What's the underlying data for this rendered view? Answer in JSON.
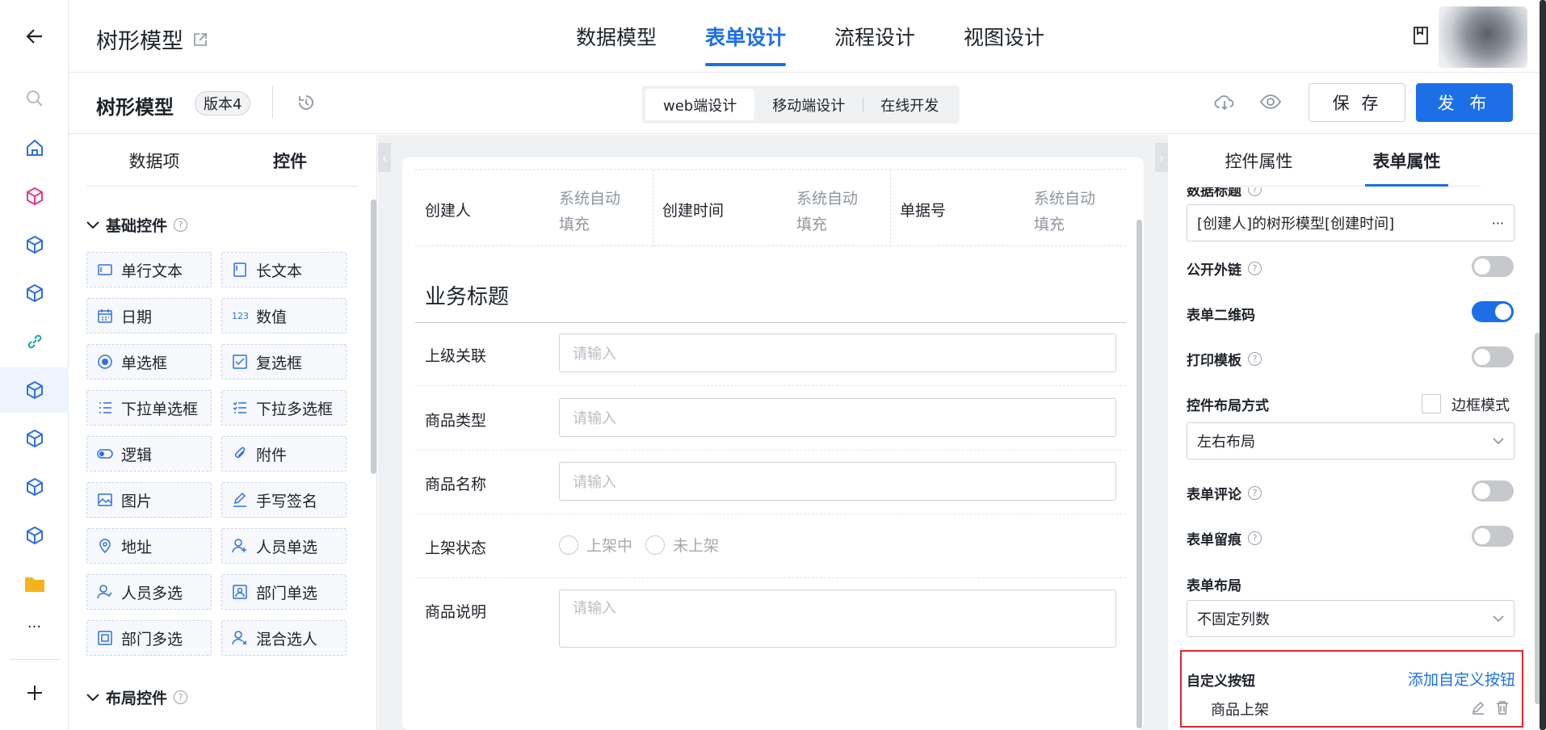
{
  "top": {
    "app_title": "树形模型",
    "tabs": [
      {
        "label": "数据模型",
        "active": false
      },
      {
        "label": "表单设计",
        "active": true
      },
      {
        "label": "流程设计",
        "active": false
      },
      {
        "label": "视图设计",
        "active": false
      }
    ]
  },
  "sub": {
    "title": "树形模型",
    "version": "版本4",
    "segments": [
      {
        "label": "web端设计",
        "active": true
      },
      {
        "label": "移动端设计",
        "active": false
      },
      {
        "label": "在线开发",
        "active": false
      }
    ],
    "save": "保 存",
    "publish": "发 布"
  },
  "left": {
    "tabs": [
      {
        "label": "数据项",
        "active": false
      },
      {
        "label": "控件",
        "active": true
      }
    ],
    "basic_section": "基础控件",
    "layout_section": "布局控件",
    "controls": [
      {
        "label": "单行文本",
        "icon": "single-line-text-icon"
      },
      {
        "label": "长文本",
        "icon": "long-text-icon"
      },
      {
        "label": "日期",
        "icon": "calendar-icon"
      },
      {
        "label": "数值",
        "icon": "number-icon"
      },
      {
        "label": "单选框",
        "icon": "radio-icon"
      },
      {
        "label": "复选框",
        "icon": "checkbox-icon"
      },
      {
        "label": "下拉单选框",
        "icon": "dropdown-single-icon"
      },
      {
        "label": "下拉多选框",
        "icon": "dropdown-multi-icon"
      },
      {
        "label": "逻辑",
        "icon": "toggle-icon"
      },
      {
        "label": "附件",
        "icon": "paperclip-icon"
      },
      {
        "label": "图片",
        "icon": "image-icon"
      },
      {
        "label": "手写签名",
        "icon": "pen-icon"
      },
      {
        "label": "地址",
        "icon": "location-icon"
      },
      {
        "label": "人员单选",
        "icon": "user-add-icon"
      },
      {
        "label": "人员多选",
        "icon": "users-icon"
      },
      {
        "label": "部门单选",
        "icon": "department-icon"
      },
      {
        "label": "部门多选",
        "icon": "department-multi-icon"
      },
      {
        "label": "混合选人",
        "icon": "user-mixed-icon"
      }
    ]
  },
  "form": {
    "system_fields": [
      {
        "label": "创建人",
        "value_line1": "系统自动",
        "value_line2": "填充"
      },
      {
        "label": "创建时间",
        "value_line1": "系统自动",
        "value_line2": "填充"
      },
      {
        "label": "单据号",
        "value_line1": "系统自动",
        "value_line2": "填充"
      }
    ],
    "business_title": "业务标题",
    "fields": [
      {
        "label": "上级关联",
        "placeholder": "请输入"
      },
      {
        "label": "商品类型",
        "placeholder": "请输入"
      },
      {
        "label": "商品名称",
        "placeholder": "请输入"
      }
    ],
    "status": {
      "label": "上架状态",
      "options": [
        "上架中",
        "未上架"
      ]
    },
    "desc": {
      "label": "商品说明",
      "placeholder": "请输入"
    }
  },
  "right": {
    "tabs": [
      {
        "label": "控件属性",
        "active": false
      },
      {
        "label": "表单属性",
        "active": true
      }
    ],
    "data_title_label": "数据标题",
    "data_title_value": "[创建人]的树形模型[创建时间]",
    "more": "···",
    "public_link": {
      "label": "公开外链",
      "on": false
    },
    "qr_code": {
      "label": "表单二维码",
      "on": true
    },
    "print_template": {
      "label": "打印模板",
      "on": false
    },
    "layout_mode_label": "控件布局方式",
    "border_mode_label": "边框模式",
    "layout_mode_value": "左右布局",
    "comments": {
      "label": "表单评论",
      "on": false
    },
    "trace": {
      "label": "表单留痕",
      "on": false
    },
    "form_layout_label": "表单布局",
    "form_layout_value": "不固定列数",
    "custom_button_label": "自定义按钮",
    "add_custom_button": "添加自定义按钮",
    "custom_buttons": [
      {
        "label": "商品上架"
      }
    ]
  },
  "colors": {
    "primary": "#1d6fe8",
    "highlight_border": "#e0282e"
  }
}
